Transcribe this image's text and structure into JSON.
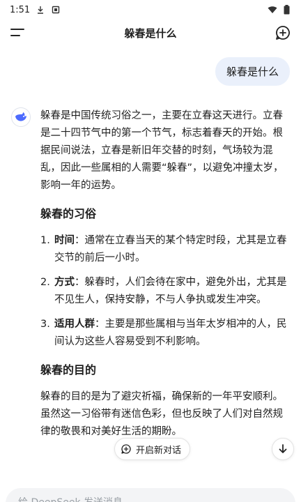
{
  "status_bar": {
    "time": "1:51",
    "icons": [
      "download-icon",
      "notification-icon",
      "wifi-icon",
      "battery-icon"
    ]
  },
  "header": {
    "title": "躲春是什么",
    "menu_icon": "menu-icon",
    "new_chat_icon": "new-chat-icon"
  },
  "user_message": "躲春是什么",
  "assistant": {
    "avatar_icon": "whale-icon",
    "intro": "躲春是中国传统习俗之一，主要在立春这天进行。立春是二十四节气中的第一个节气，标志着春天的开始。根据民间说法，立春是新旧年交替的时刻，气场较为混乱，因此一些属相的人需要“躲春”，以避免冲撞太岁，影响一年的运势。",
    "section1_title": "躲春的习俗",
    "customs": [
      {
        "num": "1.",
        "term": "时间",
        "text": "：通常在立春当天的某个特定时段，尤其是立春交节的前后一小时。"
      },
      {
        "num": "2.",
        "term": "方式",
        "text": "：躲春时，人们会待在家中，避免外出，尤其是不见生人，保持安静，不与人争执或发生冲突。"
      },
      {
        "num": "3.",
        "term": "适用人群",
        "text": "：主要是那些属相与当年太岁相冲的人，民间认为这些人容易受到不利影响。"
      }
    ],
    "section2_title": "躲春的目的",
    "purpose": "躲春的目的是为了避灾祈福，确保新的一年平安顺利。虽然这一习俗带有迷信色彩，但也反映了人们对自然规律的敬畏和对美好生活的期盼。"
  },
  "floating": {
    "new_dialog_label": "开启新对话",
    "new_dialog_icon": "new-chat-icon",
    "scroll_down_icon": "arrow-down-icon"
  },
  "input": {
    "placeholder": "给 DeepSeek 发送消息"
  },
  "colors": {
    "accent": "#4d6bfe",
    "user_bubble": "#eaf0fb"
  }
}
